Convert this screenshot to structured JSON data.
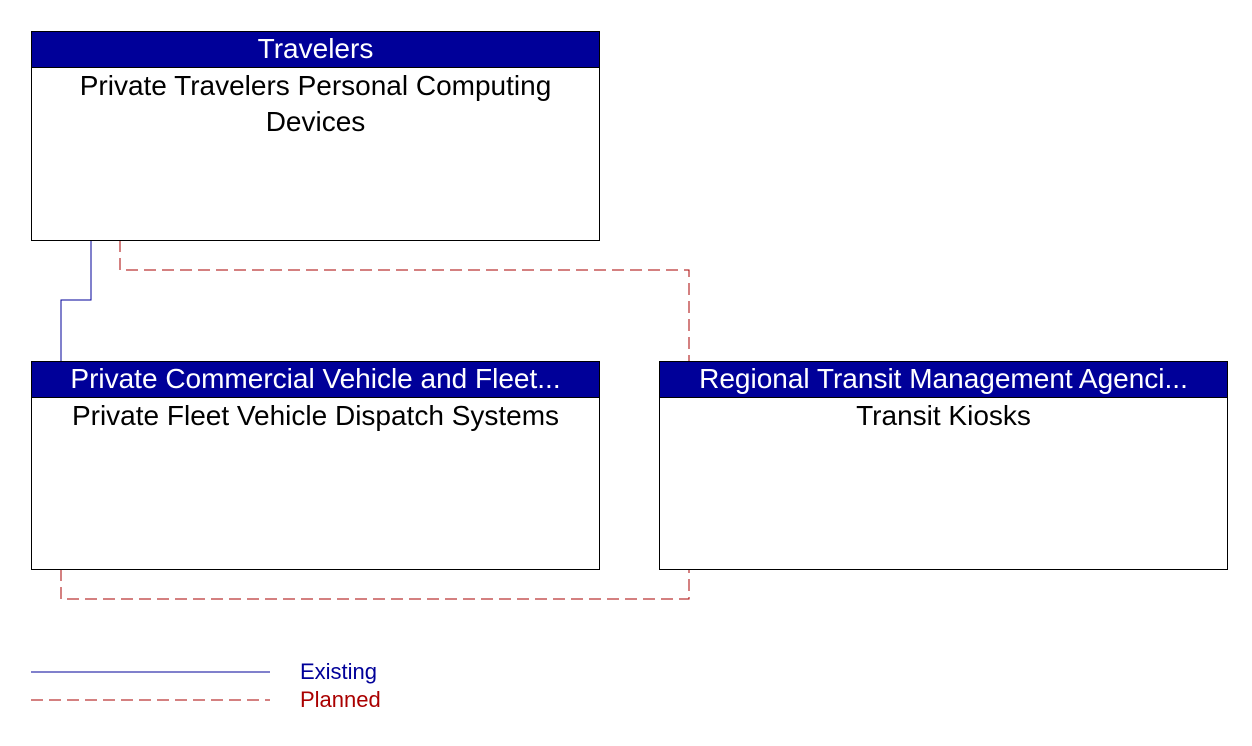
{
  "nodes": [
    {
      "id": "travelers",
      "header": "Travelers",
      "body": "Private Travelers Personal Computing Devices"
    },
    {
      "id": "fleet",
      "header": "Private Commercial Vehicle and Fleet...",
      "body": "Private Fleet Vehicle Dispatch Systems"
    },
    {
      "id": "kiosks",
      "header": "Regional Transit Management Agenci...",
      "body": "Transit Kiosks"
    }
  ],
  "connections": [
    {
      "from": "travelers",
      "to": "fleet",
      "status": "Existing"
    },
    {
      "from": "travelers",
      "to": "kiosks",
      "status": "Planned"
    },
    {
      "from": "fleet",
      "to": "kiosks",
      "status": "Planned"
    }
  ],
  "legend": {
    "existing": {
      "label": "Existing",
      "color": "#000099"
    },
    "planned": {
      "label": "Planned",
      "color": "#aa0000"
    }
  }
}
